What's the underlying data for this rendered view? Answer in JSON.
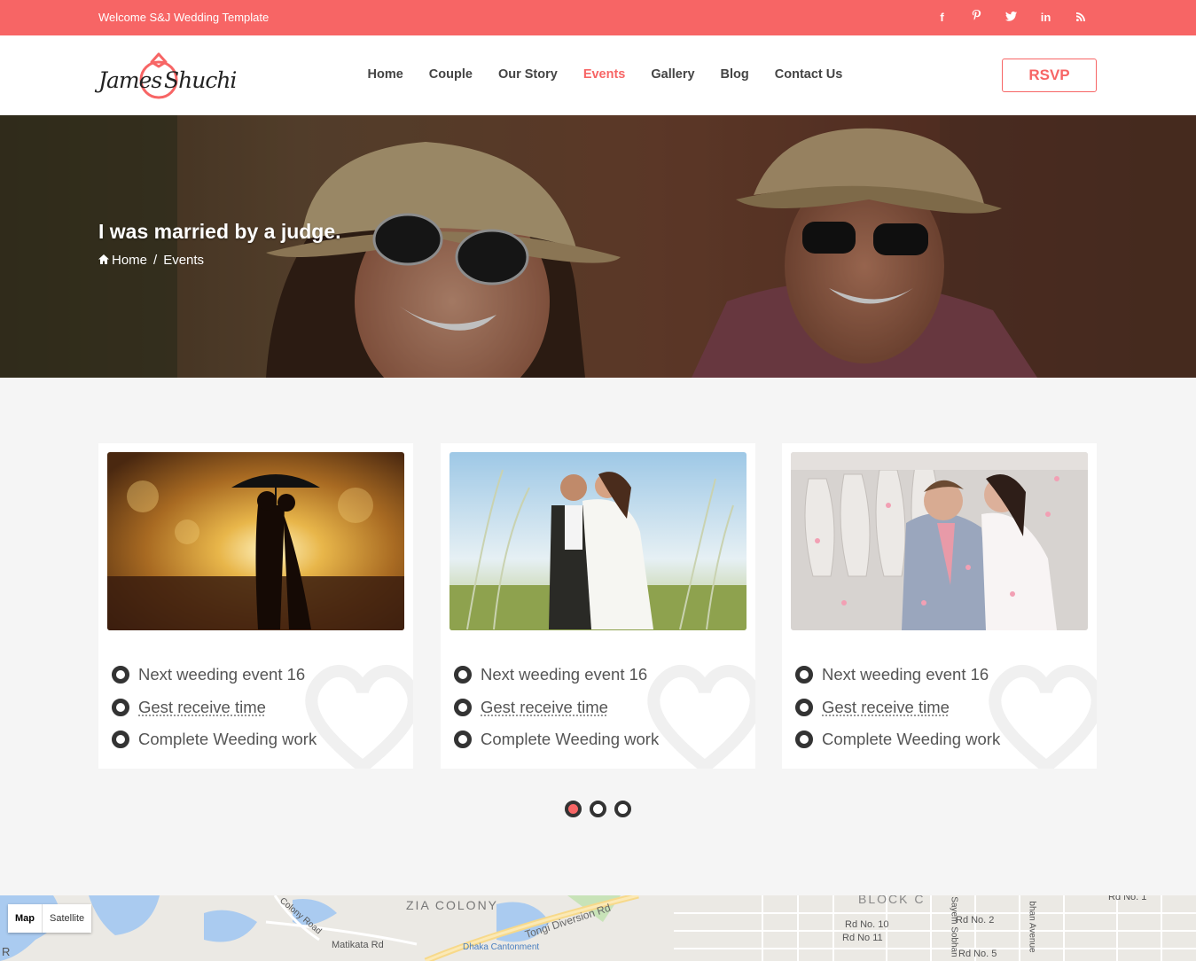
{
  "topbar": {
    "welcome": "Welcome S&J Wedding Template",
    "social": [
      {
        "icon": "facebook-icon",
        "glyph": "f"
      },
      {
        "icon": "pinterest-icon",
        "glyph": "𝓅"
      },
      {
        "icon": "twitter-icon",
        "glyph": "🐦"
      },
      {
        "icon": "linkedin-icon",
        "glyph": "in"
      },
      {
        "icon": "rss-icon",
        "glyph": "⟟"
      }
    ]
  },
  "header": {
    "logo_name_1": "James",
    "logo_name_2": "Shuchi",
    "nav": [
      "Home",
      "Couple",
      "Our Story",
      "Events",
      "Gallery",
      "Blog",
      "Contact Us"
    ],
    "active_nav": "Events",
    "rsvp_label": "RSVP"
  },
  "hero": {
    "title": "I was married by a judge.",
    "breadcrumb": {
      "home": "Home",
      "separator": "/",
      "current": "Events"
    }
  },
  "events": {
    "cards": [
      {
        "items": [
          "Next weeding event 16",
          "Gest receive time",
          "Complete Weeding work"
        ]
      },
      {
        "items": [
          "Next weeding event 16",
          "Gest receive time",
          "Complete Weeding work"
        ]
      },
      {
        "items": [
          "Next weeding event 16",
          "Gest receive time",
          "Complete Weeding work"
        ]
      }
    ],
    "slider_active": 1,
    "slider_count": 3
  },
  "map": {
    "tab_map": "Map",
    "tab_satellite": "Satellite",
    "labels": [
      "ZIA COLONY",
      "Tongi Diversion Rd",
      "Matikata Rd",
      "Dhaka Cantonment",
      "Colony Road",
      "BLOCK C",
      "Rd No. 10",
      "Rd No 11",
      "Rd No. 2",
      "Rd No. 5",
      "Sayem Sobhan",
      "bhan Avenue",
      "Rd No. 1",
      "R"
    ]
  },
  "colors": {
    "accent": "#f76565",
    "dark": "#333333",
    "background": "#f5f5f5"
  }
}
